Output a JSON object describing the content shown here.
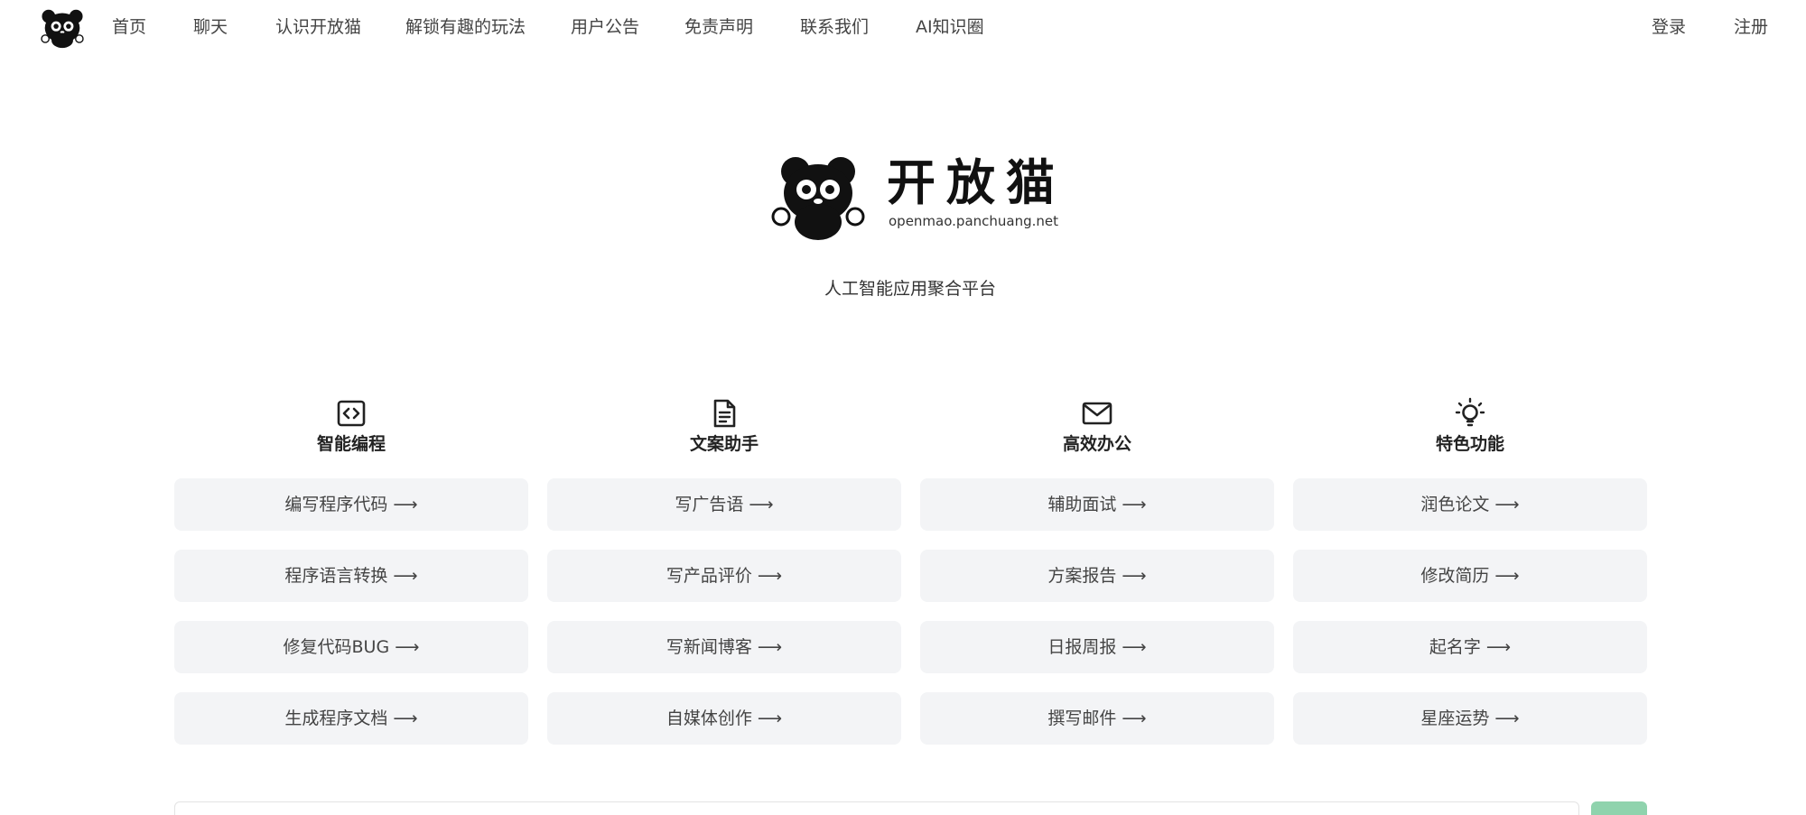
{
  "nav": {
    "items": [
      {
        "label": "首页"
      },
      {
        "label": "聊天"
      },
      {
        "label": "认识开放猫"
      },
      {
        "label": "解锁有趣的玩法"
      },
      {
        "label": "用户公告"
      },
      {
        "label": "免责声明"
      },
      {
        "label": "联系我们"
      },
      {
        "label": "AI知识圈"
      }
    ],
    "login": "登录",
    "register": "注册"
  },
  "hero": {
    "brand_name": "开放猫",
    "brand_url": "openmao.panchuang.net",
    "slogan": "人工智能应用聚合平台"
  },
  "columns": [
    {
      "icon": "code-icon",
      "title": "智能编程",
      "items": [
        "编写程序代码 ⟶",
        "程序语言转换 ⟶",
        "修复代码BUG ⟶",
        "生成程序文档 ⟶"
      ]
    },
    {
      "icon": "document-icon",
      "title": "文案助手",
      "items": [
        "写广告语 ⟶",
        "写产品评价 ⟶",
        "写新闻博客 ⟶",
        "自媒体创作 ⟶"
      ]
    },
    {
      "icon": "mail-icon",
      "title": "高效办公",
      "items": [
        "辅助面试 ⟶",
        "方案报告 ⟶",
        "日报周报 ⟶",
        "撰写邮件 ⟶"
      ]
    },
    {
      "icon": "lightbulb-icon",
      "title": "特色功能",
      "items": [
        "润色论文 ⟶",
        "修改简历 ⟶",
        "起名字 ⟶",
        "星座运势 ⟶"
      ]
    }
  ],
  "colors": {
    "card_bg": "#f3f4f6",
    "send_button": "#8fd3ad"
  }
}
